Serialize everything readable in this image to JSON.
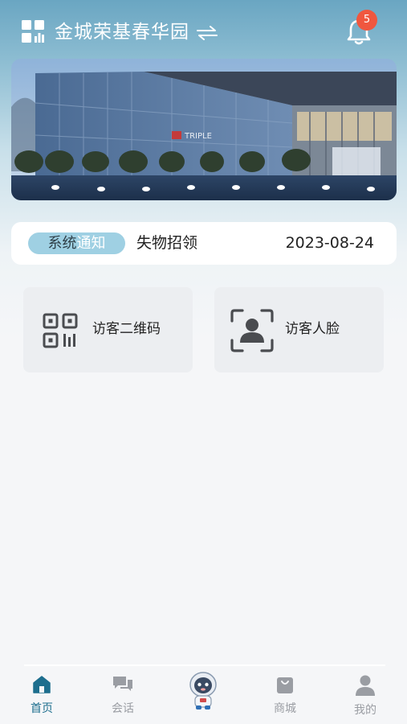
{
  "header": {
    "community_name": "金城荣基春华园",
    "notification_count": "5"
  },
  "banner": {
    "building_sign": "TRIPLE"
  },
  "notice": {
    "tag_part1": "系统",
    "tag_part2": "通知",
    "text": "失物招领",
    "date": "2023-08-24"
  },
  "functions": [
    {
      "label": "访客二维码",
      "icon": "qr-code-icon"
    },
    {
      "label": "访客人脸",
      "icon": "face-scan-icon"
    }
  ],
  "tabbar": {
    "items": [
      {
        "label": "首页",
        "icon": "home-icon",
        "active": true
      },
      {
        "label": "会话",
        "icon": "chat-icon",
        "active": false
      },
      {
        "label": "",
        "icon": "astronaut-mascot-icon",
        "active": false
      },
      {
        "label": "商城",
        "icon": "shopping-bag-icon",
        "active": false
      },
      {
        "label": "我的",
        "icon": "person-icon",
        "active": false
      }
    ]
  },
  "colors": {
    "accent": "#1d6e8e",
    "badge": "#f0573f",
    "tag_bg": "#9fd0e3"
  }
}
